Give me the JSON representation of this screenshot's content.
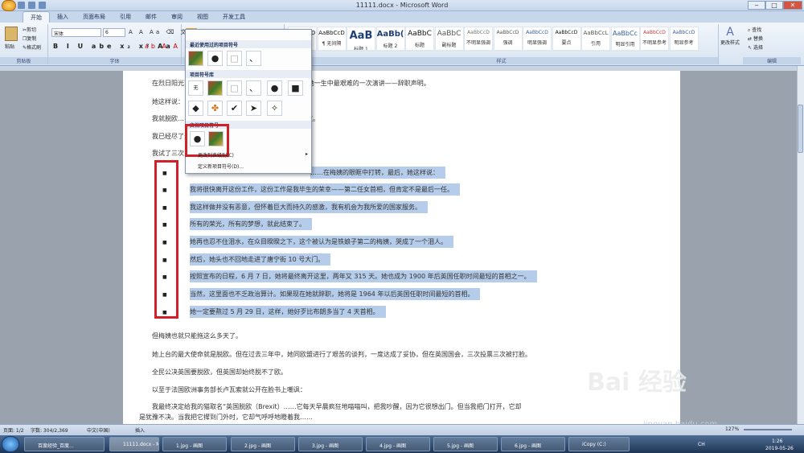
{
  "window": {
    "title": "11111.docx - Microsoft Word"
  },
  "ribbon": {
    "tabs": [
      "开始",
      "插入",
      "页面布局",
      "引用",
      "邮件",
      "审阅",
      "视图",
      "开发工具"
    ],
    "clipboard": {
      "paste": "粘贴",
      "cut": "剪切",
      "copy": "复制",
      "format_painter": "格式刷",
      "group": "剪贴板"
    },
    "font": {
      "name": "宋体",
      "size": "6",
      "group": "字体"
    },
    "paragraph": {
      "group": "段落"
    },
    "styles": {
      "group": "样式",
      "items": [
        {
          "sample": "AaBbCcD",
          "label": "¶ 正文"
        },
        {
          "sample": "AaBbCcD",
          "label": "¶ 无间隔"
        },
        {
          "sample": "AaB",
          "label": "标题 1"
        },
        {
          "sample": "AaBb(",
          "label": "标题 2"
        },
        {
          "sample": "AaBbC",
          "label": "标题"
        },
        {
          "sample": "AaBbC",
          "label": "副标题"
        },
        {
          "sample": "AaBbCcD",
          "label": "不明显强调"
        },
        {
          "sample": "AaBbCcD",
          "label": "强调"
        },
        {
          "sample": "AaBbCcD",
          "label": "明显强调"
        },
        {
          "sample": "AaBbCcD",
          "label": "要点"
        },
        {
          "sample": "AaBbCcL",
          "label": "引用"
        },
        {
          "sample": "AaBbCc",
          "label": "明显引用"
        },
        {
          "sample": "AaBbCcD",
          "label": "不明显参考"
        },
        {
          "sample": "AaBbCcD",
          "label": "明显参考"
        }
      ]
    },
    "change_styles": "更改样式",
    "editing": {
      "find": "查找",
      "replace": "替换",
      "select": "选择",
      "group": "编辑"
    }
  },
  "dropdown": {
    "recent_header": "最近使用过的项目符号",
    "library_header": "项目符号库",
    "library_none": "无",
    "doc_header": "文档项目符号",
    "change_level": "更改列表级别(C)",
    "define_new": "定义新项目符号(D)..."
  },
  "document": {
    "lines": [
      "在烈日阳光下，特雷莎·梅在唐宁街 10 号门口，发表了她一生中最艰难的一次演讲——辞职声明。",
      "她这样说：",
      "我就脱欧……我的工作，以保护我们的工作、安全和国家。",
      "我已经尽了最大努力……遗憾的是，我没能做到。",
      "我试了三次……"
    ],
    "bullets": [
      "……在梅姨的眼眶中打转，最后，她这样说：",
      "我将很快离开这份工作，这份工作是我毕生的荣幸——第二任女首相，但肯定不是最后一任。",
      "我这样做并没有恶意，但怀着巨大而持久的感激，我有机会为我所爱的国家服务。",
      "所有的荣光，所有的梦想，就此结束了。",
      "她再也忍不住泪水，在众目睽睽之下，这个被认为是铁娘子第二的梅姨，哭成了一个泪人。",
      "然后，她头也不回地走进了唐宁街 10 号大门。",
      "按照宣布的日程，6 月 7 日，她将最终离开这里，两年又 315 天。她也成为 1900 年后英国任职时间最短的首相之一。",
      "当然，这里面也不乏政治算计。如果现在她就辞职，她将是 1964 年以后英国任职时间最短的首相。",
      "她一定要熬过 5 月 29 日，这样，她好歹比布朗多当了 4 天首相。"
    ],
    "after": [
      "但梅姨也就只能拖这么多天了。",
      "她上台的最大使命就是脱欧。但在过去三年中，她同欧盟进行了艰苦的谈判，一度达成了妥协，但在英国国会，三次投票三次被打脸。",
      "全民公决英国要脱欧，但英国却始终脱不了欧。",
      "以至于法国欧洲事务部长卢瓦索就公开在脸书上嘲讽：",
      "我最终决定给我的猫取名“英国脱欧（Brexit）……它每天早晨疯狂地喵喵叫，把我吵醒，因为它很想出门。但当我把门打开，它却",
      "是犹豫不决。当我把它撵到门外时，它却气呼呼地瞪着我……"
    ]
  },
  "status": {
    "page": "页面: 1/2",
    "words": "字数: 304/2,369",
    "lang": "中文(中国)",
    "mode": "插入",
    "zoom": "127%"
  },
  "taskbar": {
    "items": [
      "百度经验_百度...",
      "11111.docx - Mi...",
      "1.jpg - 画图",
      "2.jpg - 画图",
      "3.jpg - 画图",
      "4.jpg - 画图",
      "5.jpg - 画图",
      "6.jpg - 画图",
      "iCopy (C:)"
    ],
    "lang": "CH",
    "time": "1:26",
    "date": "2019-05-26"
  },
  "watermark": {
    "text": "Bai 经验",
    "url": "jingyan.baidu.com"
  }
}
